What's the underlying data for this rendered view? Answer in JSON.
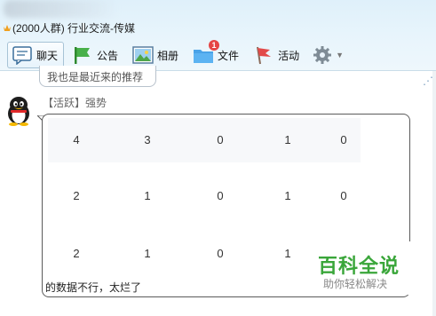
{
  "window": {
    "title": "(2000人群) 行业交流-传媒"
  },
  "toolbar": {
    "items": [
      {
        "label": "聊天",
        "icon": "chat-icon",
        "active": true
      },
      {
        "label": "公告",
        "icon": "announcement-flag-icon"
      },
      {
        "label": "相册",
        "icon": "photo-album-icon"
      },
      {
        "label": "文件",
        "icon": "folder-icon",
        "badge": "1"
      },
      {
        "label": "活动",
        "icon": "red-flag-icon"
      }
    ],
    "settings_icon": "gear-icon",
    "more_icon": "chevron-down-icon"
  },
  "chat": {
    "prev_message": "我也是最近来的推荐",
    "sender": "【活跃】强势",
    "table_rows": [
      [
        "4",
        "3",
        "0",
        "1",
        "0"
      ],
      [
        "2",
        "1",
        "0",
        "1",
        "0"
      ],
      [
        "2",
        "1",
        "0",
        "1",
        ""
      ]
    ],
    "caption": "的数据不行，太烂了"
  },
  "watermark": {
    "main": "百科全说",
    "sub": "助你轻松解决"
  },
  "colors": {
    "header_bg": "#e4f2fb",
    "badge": "#e54545",
    "watermark_green": "#3aa63a"
  }
}
